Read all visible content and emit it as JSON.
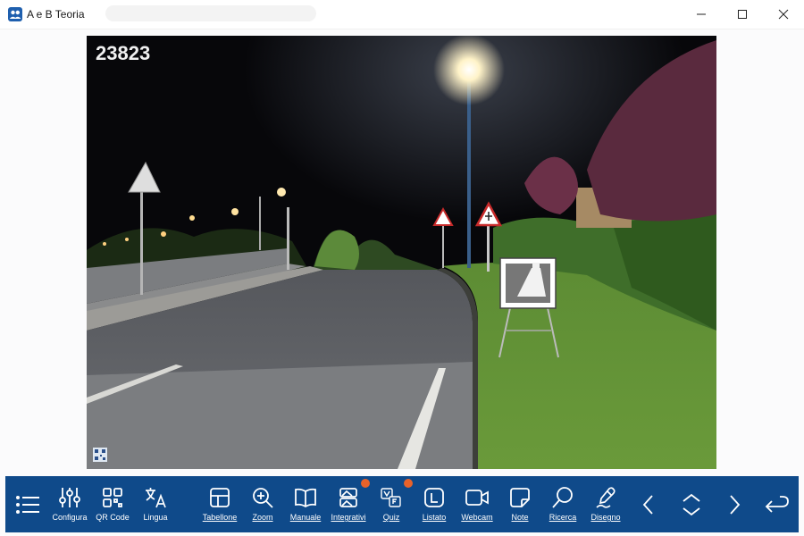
{
  "window": {
    "title": "A e B Teoria",
    "icon": "people-icon",
    "controls": [
      "minimize-icon",
      "maximize-icon",
      "close-icon"
    ]
  },
  "question": {
    "number": "23823",
    "watermark_icon": "qr-badge-icon"
  },
  "toolbar": {
    "accent": "#0f4a8a",
    "badge_color": "#e8622a",
    "menu_icon": "menu-list-icon",
    "items": [
      {
        "label": "Configura",
        "icon": "sliders-icon"
      },
      {
        "label": "QR Code",
        "icon": "qr-code-icon"
      },
      {
        "label": "Lingua",
        "icon": "translate-icon"
      },
      {
        "label": "Tabellone",
        "icon": "table-grid-icon"
      },
      {
        "label": "Zoom",
        "icon": "zoom-in-icon"
      },
      {
        "label": "Manuale",
        "icon": "book-icon"
      },
      {
        "label": "Integrativi",
        "icon": "images-icon"
      },
      {
        "label": "Quiz",
        "icon": "quiz-vf-icon"
      },
      {
        "label": "Listato",
        "icon": "letter-l-icon"
      },
      {
        "label": "Webcam",
        "icon": "camera-icon"
      },
      {
        "label": "Note",
        "icon": "sticky-note-icon"
      },
      {
        "label": "Ricerca",
        "icon": "search-icon"
      },
      {
        "label": "Disegno",
        "icon": "pen-icon"
      }
    ],
    "nav": [
      "chevron-left-icon",
      "chevron-up-down-icon",
      "chevron-right-icon",
      "return-icon"
    ]
  }
}
